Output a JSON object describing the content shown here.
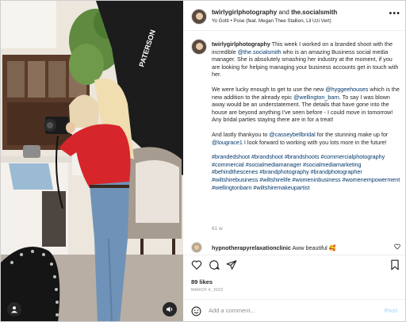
{
  "photo": {
    "sign_text": "PATERSON"
  },
  "post": {
    "username": "twirlygirlphotography",
    "and_text": "and",
    "collaborator": "the.socialsmith",
    "audio": "Yo Gotti • Pose (feat. Megan Thee Stallion, Lil Uzi Vert)",
    "caption": {
      "author": "twirlygirlphotography",
      "p1_a": " This week I worked on a branded shoot with the incredible ",
      "p1_mention": "@the.socialsmith",
      "p1_b": " who is an amazing Business social media manager. She is absolutely smashing her industry at the moment, if you are looking for helping managing your business accounts get in touch with her.",
      "p2_a": "We were lucky enough to get to use the new ",
      "p2_mention1": "@hyggeehouses",
      "p2_b": " which is the new addition to the already epic ",
      "p2_mention2": "@wellington_barn",
      "p2_c": ". To say I was blown away would be an understatement. The details that have gone into the house are beyond anything I've seen before - I could move in tomorrow! Any bridal parties staying there are in for a treat!",
      "p3_a": "And lastly thankyou to ",
      "p3_mention1": "@casseybellbridal",
      "p3_b": " for the stunning make up for ",
      "p3_mention2": "@lougrace1",
      "p3_c": " I look forward to working with you lots more in the future!",
      "hashtags": "#brandedshoot #brandshoot #brandshoots #commercialphotography #commercial #socialmediamanager #socialmediamarketing #behindthescenes #brandphotography #brandphotographer #wiltshirebusiness #wiltshirelife #womeninbusiness #womenempowerment #wellingtonbarn #wiltshiremakeupartist"
    },
    "time_ago": "61 w"
  },
  "comment": {
    "username": "hypnotherapyrelaxationclinic",
    "text": " Aww beautiful ",
    "emoji": "🥰"
  },
  "likes": "89 likes",
  "date": "MARCH 4, 2022",
  "add_comment": {
    "placeholder": "Add a comment...",
    "post_label": "Post"
  },
  "colors": {
    "link": "#00376b",
    "post_button": "#b2dffc",
    "shirt": "#d7262b"
  }
}
